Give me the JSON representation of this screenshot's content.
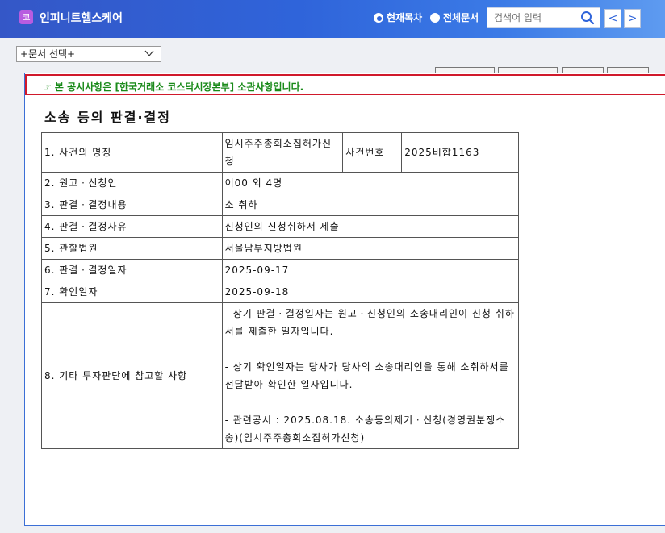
{
  "header": {
    "logo_glyph": "코",
    "company": "인피니트헬스케어",
    "radio_current": "현재목차",
    "radio_all": "전체문서",
    "search_placeholder": "검색어 입력",
    "prev": "<",
    "next": ">"
  },
  "doc_select": {
    "value": "+문서 선택+"
  },
  "notice": "☞ 본 공시사항은 [한국거래소 코스닥시장본부] 소관사항입니다.",
  "doc_title": "소송 등의 판결·결정",
  "rows": {
    "r1": {
      "label": "1. 사건의 명칭",
      "value": "임시주주총회소집허가신청",
      "sub_label": "사건번호",
      "sub_value": "2025비합1163"
    },
    "r2": {
      "label": "2. 원고ㆍ신청인",
      "value": "이00 외 4명"
    },
    "r3": {
      "label": "3. 판결ㆍ결정내용",
      "value": "소 취하"
    },
    "r4": {
      "label": "4. 판결ㆍ결정사유",
      "value": "신청인의 신청취하서 제출"
    },
    "r5": {
      "label": "5. 관할법원",
      "value": "서울남부지방법원"
    },
    "r6": {
      "label": "6. 판결ㆍ결정일자",
      "value": "2025-09-17"
    },
    "r7": {
      "label": "7. 확인일자",
      "value": "2025-09-18"
    },
    "r8": {
      "label": "8. 기타 투자판단에 참고할 사항",
      "p1": "- 상기 판결ㆍ결정일자는 원고ㆍ신청인의 소송대리인이 신청 취하서를 제출한 일자입니다.",
      "p2": "- 상기 확인일자는 당사가 당사의 소송대리인을 통해 소취하서를 전달받아 확인한 일자입니다.",
      "p3": "- 관련공시 : 2025.08.18. 소송등의제기ㆍ신청(경영권분쟁소송)(임시주주총회소집허가신청)"
    }
  }
}
